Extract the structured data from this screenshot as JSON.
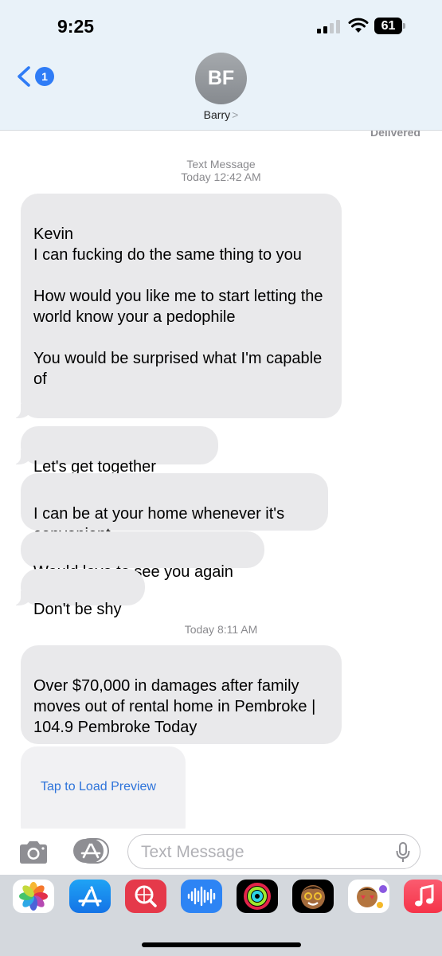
{
  "status_bar": {
    "time": "9:25",
    "battery": "61"
  },
  "header": {
    "back_count": "1",
    "avatar_initials": "BF",
    "contact_name": "Barry",
    "contact_chevron": ">"
  },
  "thread": {
    "delivered_label": "Delivered",
    "timestamp_1": {
      "label": "Text Message",
      "time": "Today 12:42 AM"
    },
    "messages_1": [
      "Kevin\nI can fucking do the same thing to you\n\nHow would you like me to start letting the world know your a pedophile\n\nYou would be surprised what I'm capable of\n",
      "Let's get together",
      "I can be at your home whenever it's convenient",
      "Would love to see you again",
      "Don't be shy"
    ],
    "heart_emoji": "❤️",
    "timestamp_2": {
      "time": "Today 8:11 AM"
    },
    "link_message": "Over $70,000 in damages after family moves out of rental home in Pembroke | 104.9 Pembroke Today",
    "preview_label": "Tap to Load Preview"
  },
  "input_bar": {
    "placeholder": "Text Message"
  },
  "app_drawer": {
    "apps": [
      "photos-app",
      "app-store-app",
      "images-search-app",
      "audio-message-app",
      "activity-app",
      "memoji-app",
      "memoji-stickers-app",
      "music-app"
    ]
  },
  "colors": {
    "bubble_gray": "#e9e9eb",
    "link_blue": "#2d73da",
    "ios_blue": "#2f7cf6",
    "header_bg": "#e9f2f9"
  }
}
